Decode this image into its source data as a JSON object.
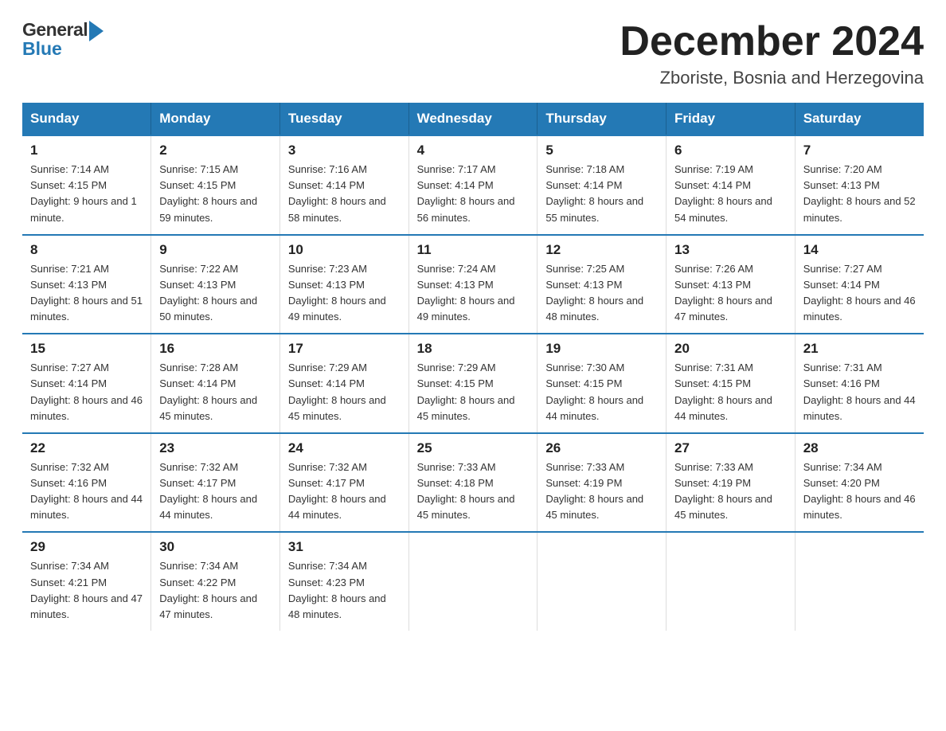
{
  "header": {
    "logo_line1": "General",
    "logo_line2": "Blue",
    "month_title": "December 2024",
    "location": "Zboriste, Bosnia and Herzegovina"
  },
  "weekdays": [
    "Sunday",
    "Monday",
    "Tuesday",
    "Wednesday",
    "Thursday",
    "Friday",
    "Saturday"
  ],
  "weeks": [
    [
      {
        "day": "1",
        "sunrise": "7:14 AM",
        "sunset": "4:15 PM",
        "daylight": "9 hours and 1 minute."
      },
      {
        "day": "2",
        "sunrise": "7:15 AM",
        "sunset": "4:15 PM",
        "daylight": "8 hours and 59 minutes."
      },
      {
        "day": "3",
        "sunrise": "7:16 AM",
        "sunset": "4:14 PM",
        "daylight": "8 hours and 58 minutes."
      },
      {
        "day": "4",
        "sunrise": "7:17 AM",
        "sunset": "4:14 PM",
        "daylight": "8 hours and 56 minutes."
      },
      {
        "day": "5",
        "sunrise": "7:18 AM",
        "sunset": "4:14 PM",
        "daylight": "8 hours and 55 minutes."
      },
      {
        "day": "6",
        "sunrise": "7:19 AM",
        "sunset": "4:14 PM",
        "daylight": "8 hours and 54 minutes."
      },
      {
        "day": "7",
        "sunrise": "7:20 AM",
        "sunset": "4:13 PM",
        "daylight": "8 hours and 52 minutes."
      }
    ],
    [
      {
        "day": "8",
        "sunrise": "7:21 AM",
        "sunset": "4:13 PM",
        "daylight": "8 hours and 51 minutes."
      },
      {
        "day": "9",
        "sunrise": "7:22 AM",
        "sunset": "4:13 PM",
        "daylight": "8 hours and 50 minutes."
      },
      {
        "day": "10",
        "sunrise": "7:23 AM",
        "sunset": "4:13 PM",
        "daylight": "8 hours and 49 minutes."
      },
      {
        "day": "11",
        "sunrise": "7:24 AM",
        "sunset": "4:13 PM",
        "daylight": "8 hours and 49 minutes."
      },
      {
        "day": "12",
        "sunrise": "7:25 AM",
        "sunset": "4:13 PM",
        "daylight": "8 hours and 48 minutes."
      },
      {
        "day": "13",
        "sunrise": "7:26 AM",
        "sunset": "4:13 PM",
        "daylight": "8 hours and 47 minutes."
      },
      {
        "day": "14",
        "sunrise": "7:27 AM",
        "sunset": "4:14 PM",
        "daylight": "8 hours and 46 minutes."
      }
    ],
    [
      {
        "day": "15",
        "sunrise": "7:27 AM",
        "sunset": "4:14 PM",
        "daylight": "8 hours and 46 minutes."
      },
      {
        "day": "16",
        "sunrise": "7:28 AM",
        "sunset": "4:14 PM",
        "daylight": "8 hours and 45 minutes."
      },
      {
        "day": "17",
        "sunrise": "7:29 AM",
        "sunset": "4:14 PM",
        "daylight": "8 hours and 45 minutes."
      },
      {
        "day": "18",
        "sunrise": "7:29 AM",
        "sunset": "4:15 PM",
        "daylight": "8 hours and 45 minutes."
      },
      {
        "day": "19",
        "sunrise": "7:30 AM",
        "sunset": "4:15 PM",
        "daylight": "8 hours and 44 minutes."
      },
      {
        "day": "20",
        "sunrise": "7:31 AM",
        "sunset": "4:15 PM",
        "daylight": "8 hours and 44 minutes."
      },
      {
        "day": "21",
        "sunrise": "7:31 AM",
        "sunset": "4:16 PM",
        "daylight": "8 hours and 44 minutes."
      }
    ],
    [
      {
        "day": "22",
        "sunrise": "7:32 AM",
        "sunset": "4:16 PM",
        "daylight": "8 hours and 44 minutes."
      },
      {
        "day": "23",
        "sunrise": "7:32 AM",
        "sunset": "4:17 PM",
        "daylight": "8 hours and 44 minutes."
      },
      {
        "day": "24",
        "sunrise": "7:32 AM",
        "sunset": "4:17 PM",
        "daylight": "8 hours and 44 minutes."
      },
      {
        "day": "25",
        "sunrise": "7:33 AM",
        "sunset": "4:18 PM",
        "daylight": "8 hours and 45 minutes."
      },
      {
        "day": "26",
        "sunrise": "7:33 AM",
        "sunset": "4:19 PM",
        "daylight": "8 hours and 45 minutes."
      },
      {
        "day": "27",
        "sunrise": "7:33 AM",
        "sunset": "4:19 PM",
        "daylight": "8 hours and 45 minutes."
      },
      {
        "day": "28",
        "sunrise": "7:34 AM",
        "sunset": "4:20 PM",
        "daylight": "8 hours and 46 minutes."
      }
    ],
    [
      {
        "day": "29",
        "sunrise": "7:34 AM",
        "sunset": "4:21 PM",
        "daylight": "8 hours and 47 minutes."
      },
      {
        "day": "30",
        "sunrise": "7:34 AM",
        "sunset": "4:22 PM",
        "daylight": "8 hours and 47 minutes."
      },
      {
        "day": "31",
        "sunrise": "7:34 AM",
        "sunset": "4:23 PM",
        "daylight": "8 hours and 48 minutes."
      },
      null,
      null,
      null,
      null
    ]
  ]
}
